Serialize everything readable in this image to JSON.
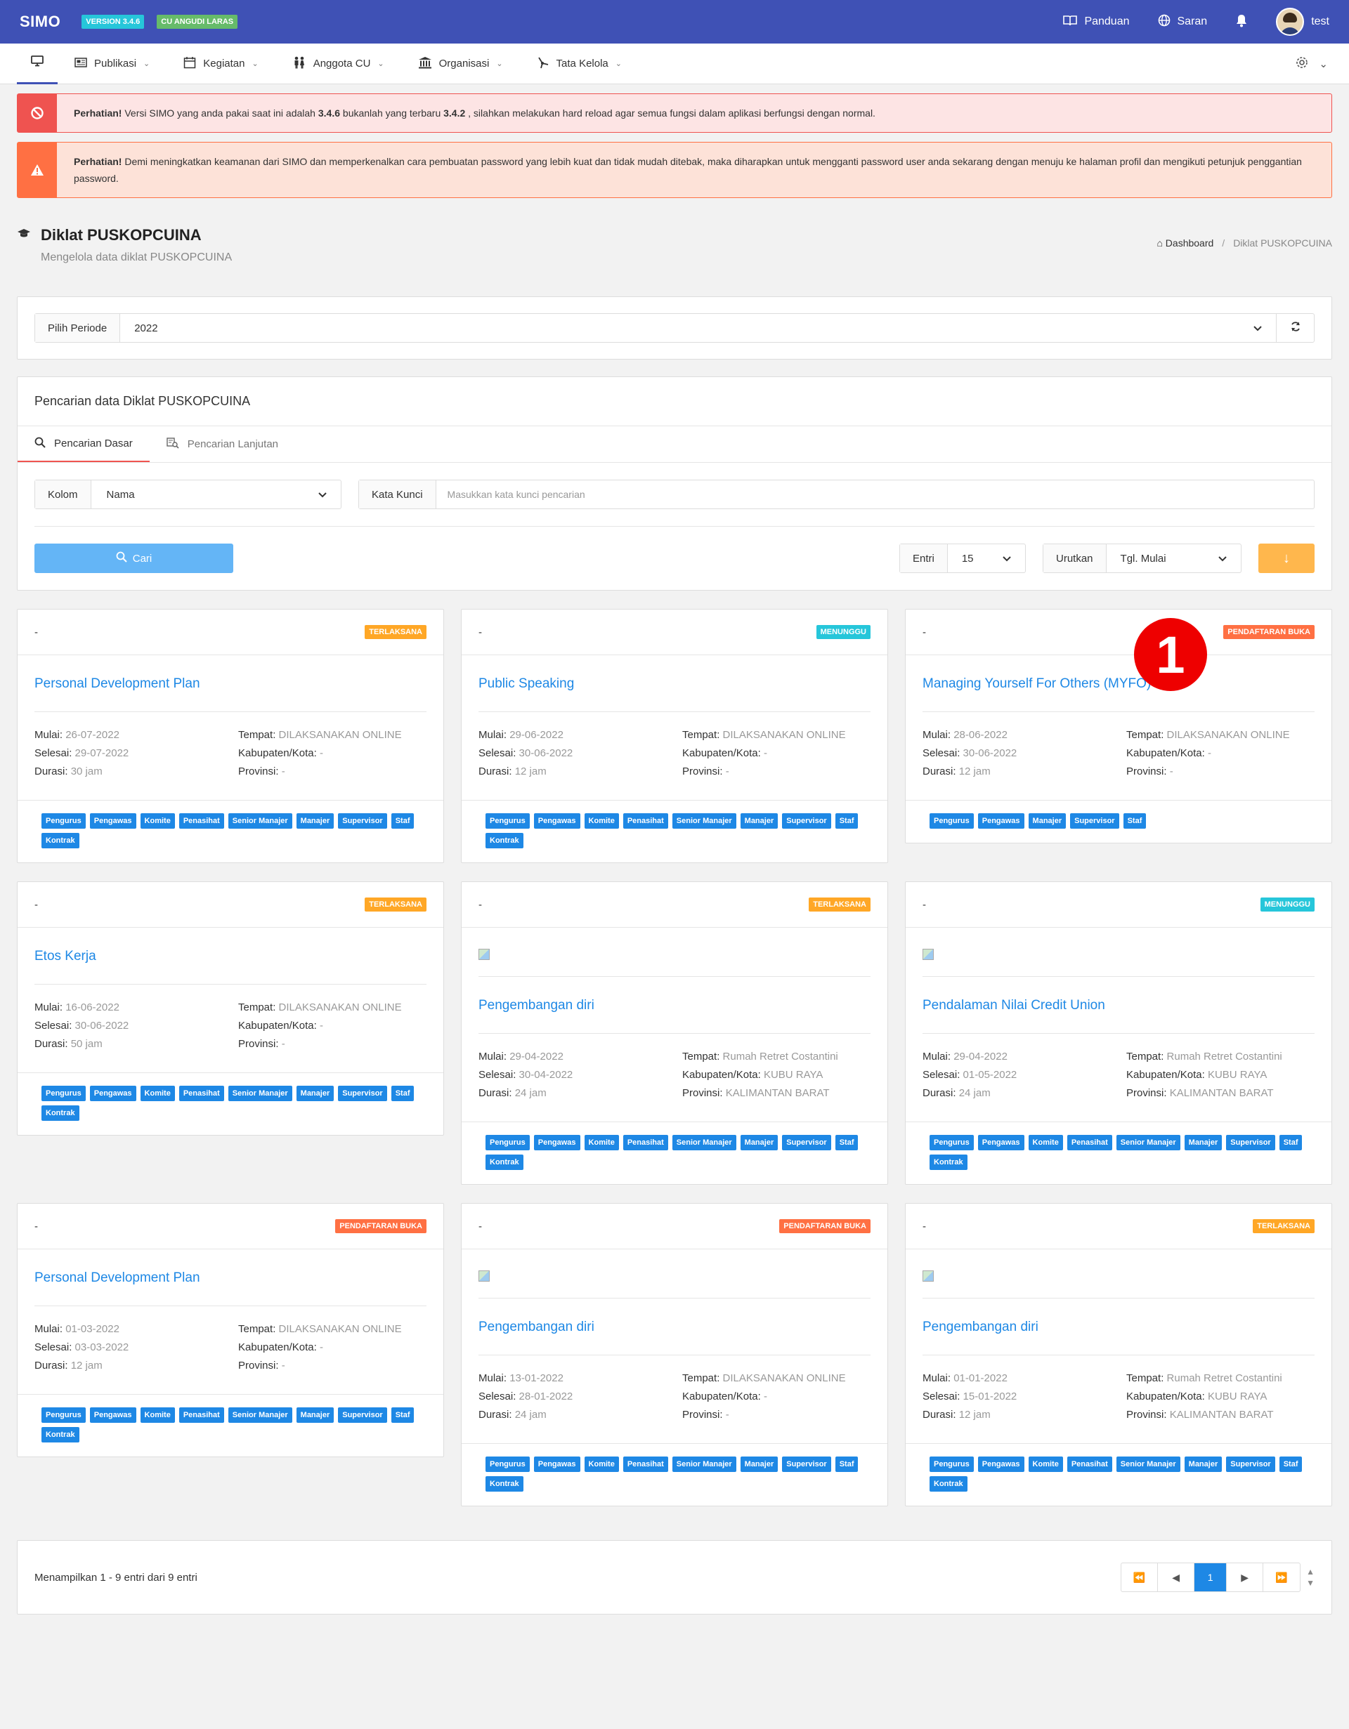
{
  "topbar": {
    "brand": "SIMO",
    "version_badge": "VERSION 3.4.6",
    "cu_badge": "CU ANGUDI LARAS",
    "panduan": "Panduan",
    "saran": "Saran",
    "user": "test"
  },
  "subnav": {
    "items": [
      {
        "label": "Publikasi"
      },
      {
        "label": "Kegiatan"
      },
      {
        "label": "Anggota CU"
      },
      {
        "label": "Organisasi"
      },
      {
        "label": "Tata Kelola"
      }
    ]
  },
  "alerts": {
    "danger": {
      "strong": "Perhatian!",
      "part1": " Versi SIMO yang anda pakai saat ini adalah ",
      "current": "3.4.6",
      "part2": " bukanlah yang terbaru ",
      "latest": "3.4.2",
      "part3": " , silahkan melakukan hard reload agar semua fungsi dalam aplikasi berfungsi dengan normal."
    },
    "warning": {
      "strong": "Perhatian!",
      "text": " Demi meningkatkan keamanan dari SIMO dan memperkenalkan cara pembuatan password yang lebih kuat dan tidak mudah ditebak, maka diharapkan untuk mengganti password user anda sekarang dengan menuju ke halaman profil dan mengikuti petunjuk penggantian password."
    }
  },
  "page": {
    "title": "Diklat PUSKOPCUINA",
    "subtitle": "Mengelola data diklat PUSKOPCUINA",
    "breadcrumb_home": "Dashboard",
    "breadcrumb_current": "Diklat PUSKOPCUINA"
  },
  "periode": {
    "label": "Pilih Periode",
    "value": "2022"
  },
  "search": {
    "heading": "Pencarian data Diklat PUSKOPCUINA",
    "tab_basic": "Pencarian Dasar",
    "tab_advanced": "Pencarian Lanjutan",
    "kolom_label": "Kolom",
    "kolom_value": "Nama",
    "kata_kunci_label": "Kata Kunci",
    "kata_kunci_placeholder": "Masukkan kata kunci pencarian",
    "cari_label": "Cari",
    "entri_label": "Entri",
    "entri_value": "15",
    "urutkan_label": "Urutkan",
    "urutkan_value": "Tgl. Mulai"
  },
  "labels": {
    "mulai": "Mulai:",
    "selesai": "Selesai:",
    "durasi": "Durasi:",
    "tempat": "Tempat:",
    "kabupaten": "Kabupaten/Kota:",
    "provinsi": "Provinsi:"
  },
  "cards": [
    {
      "head": "-",
      "status": "TERLAKSANA",
      "status_class": "st-terlaksana",
      "has_image": false,
      "title": "Personal Development Plan",
      "mulai": "26-07-2022",
      "selesai": "29-07-2022",
      "durasi": "30 jam",
      "tempat": "DILAKSANAKAN ONLINE",
      "kabupaten": "-",
      "provinsi": "-",
      "tags": [
        "Pengurus",
        "Pengawas",
        "Komite",
        "Penasihat",
        "Senior Manajer",
        "Manajer",
        "Supervisor",
        "Staf",
        "Kontrak"
      ]
    },
    {
      "head": "-",
      "status": "MENUNGGU",
      "status_class": "st-menunggu",
      "has_image": false,
      "title": "Public Speaking",
      "mulai": "29-06-2022",
      "selesai": "30-06-2022",
      "durasi": "12 jam",
      "tempat": "DILAKSANAKAN ONLINE",
      "kabupaten": "-",
      "provinsi": "-",
      "tags": [
        "Pengurus",
        "Pengawas",
        "Komite",
        "Penasihat",
        "Senior Manajer",
        "Manajer",
        "Supervisor",
        "Staf",
        "Kontrak"
      ]
    },
    {
      "head": "-",
      "status": "PENDAFTARAN BUKA",
      "status_class": "st-buka",
      "has_image": false,
      "title": "Managing Yourself For Others (MYFO)",
      "mulai": "28-06-2022",
      "selesai": "30-06-2022",
      "durasi": "12 jam",
      "tempat": "DILAKSANAKAN ONLINE",
      "kabupaten": "-",
      "provinsi": "-",
      "tags": [
        "Pengurus",
        "Pengawas",
        "Manajer",
        "Supervisor",
        "Staf"
      ]
    },
    {
      "head": "-",
      "status": "TERLAKSANA",
      "status_class": "st-terlaksana",
      "has_image": false,
      "title": "Etos Kerja",
      "mulai": "16-06-2022",
      "selesai": "30-06-2022",
      "durasi": "50 jam",
      "tempat": "DILAKSANAKAN ONLINE",
      "kabupaten": "-",
      "provinsi": "-",
      "tags": [
        "Pengurus",
        "Pengawas",
        "Komite",
        "Penasihat",
        "Senior Manajer",
        "Manajer",
        "Supervisor",
        "Staf",
        "Kontrak"
      ]
    },
    {
      "head": "-",
      "status": "TERLAKSANA",
      "status_class": "st-terlaksana",
      "has_image": true,
      "title": "Pengembangan diri",
      "mulai": "29-04-2022",
      "selesai": "30-04-2022",
      "durasi": "24 jam",
      "tempat": "Rumah Retret Costantini",
      "kabupaten": "KUBU RAYA",
      "provinsi": "KALIMANTAN BARAT",
      "tags": [
        "Pengurus",
        "Pengawas",
        "Komite",
        "Penasihat",
        "Senior Manajer",
        "Manajer",
        "Supervisor",
        "Staf",
        "Kontrak"
      ]
    },
    {
      "head": "-",
      "status": "MENUNGGU",
      "status_class": "st-menunggu",
      "has_image": true,
      "title": "Pendalaman Nilai Credit Union",
      "mulai": "29-04-2022",
      "selesai": "01-05-2022",
      "durasi": "24 jam",
      "tempat": "Rumah Retret Costantini",
      "kabupaten": "KUBU RAYA",
      "provinsi": "KALIMANTAN BARAT",
      "tags": [
        "Pengurus",
        "Pengawas",
        "Komite",
        "Penasihat",
        "Senior Manajer",
        "Manajer",
        "Supervisor",
        "Staf",
        "Kontrak"
      ]
    },
    {
      "head": "-",
      "status": "PENDAFTARAN BUKA",
      "status_class": "st-buka",
      "has_image": false,
      "title": "Personal Development Plan",
      "mulai": "01-03-2022",
      "selesai": "03-03-2022",
      "durasi": "12 jam",
      "tempat": "DILAKSANAKAN ONLINE",
      "kabupaten": "-",
      "provinsi": "-",
      "tags": [
        "Pengurus",
        "Pengawas",
        "Komite",
        "Penasihat",
        "Senior Manajer",
        "Manajer",
        "Supervisor",
        "Staf",
        "Kontrak"
      ]
    },
    {
      "head": "-",
      "status": "PENDAFTARAN BUKA",
      "status_class": "st-buka",
      "has_image": true,
      "title": "Pengembangan diri",
      "mulai": "13-01-2022",
      "selesai": "28-01-2022",
      "durasi": "24 jam",
      "tempat": "DILAKSANAKAN ONLINE",
      "kabupaten": "-",
      "provinsi": "-",
      "tags": [
        "Pengurus",
        "Pengawas",
        "Komite",
        "Penasihat",
        "Senior Manajer",
        "Manajer",
        "Supervisor",
        "Staf",
        "Kontrak"
      ]
    },
    {
      "head": "-",
      "status": "TERLAKSANA",
      "status_class": "st-terlaksana",
      "has_image": true,
      "title": "Pengembangan diri",
      "mulai": "01-01-2022",
      "selesai": "15-01-2022",
      "durasi": "12 jam",
      "tempat": "Rumah Retret Costantini",
      "kabupaten": "KUBU RAYA",
      "provinsi": "KALIMANTAN BARAT",
      "tags": [
        "Pengurus",
        "Pengawas",
        "Komite",
        "Penasihat",
        "Senior Manajer",
        "Manajer",
        "Supervisor",
        "Staf",
        "Kontrak"
      ]
    }
  ],
  "pagination": {
    "summary": "Menampilkan 1 - 9 entri dari 9 entri",
    "current_page": "1"
  },
  "annotation_badge": "1",
  "colors": {
    "topbar": "#3f51b5",
    "link": "#1e88e5",
    "terlaksana": "#ffa726",
    "menunggu": "#26c6da",
    "pendaftaran_buka": "#ff7043"
  }
}
